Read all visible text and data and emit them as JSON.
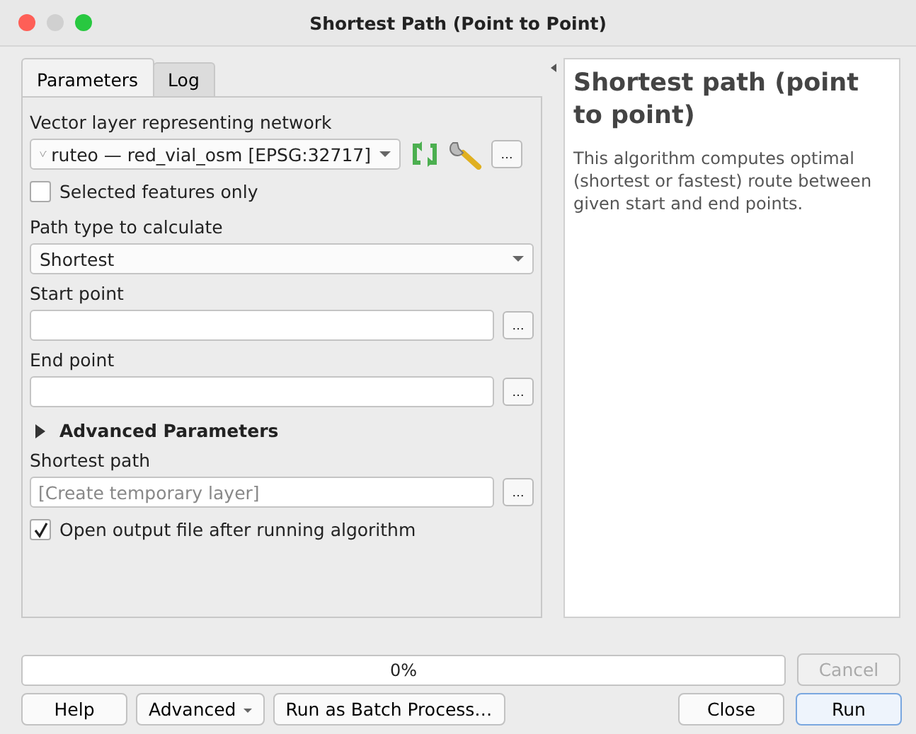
{
  "window": {
    "title": "Shortest Path (Point to Point)"
  },
  "tabs": [
    {
      "label": "Parameters",
      "selected": true
    },
    {
      "label": "Log",
      "selected": false
    }
  ],
  "parameters": [
    {
      "kind": "layer",
      "label": "Vector layer representing network",
      "value": "ruteo — red_vial_osm [EPSG:32717]",
      "button": "…"
    },
    {
      "kind": "checkbox",
      "label": "Selected features only",
      "checked": false
    },
    {
      "kind": "select",
      "label": "Path type to calculate",
      "value": "Shortest"
    },
    {
      "kind": "point",
      "label": "Start point",
      "button": "…"
    },
    {
      "kind": "point",
      "label": "End point",
      "button": "…"
    },
    {
      "kind": "group",
      "label": "Advanced Parameters",
      "expanded": false
    },
    {
      "kind": "output",
      "label": "Shortest path",
      "placeholder": "[Create temporary layer]",
      "button": "…"
    },
    {
      "kind": "checkbox",
      "label": "Open output file after running algorithm",
      "checked": true
    }
  ],
  "help": {
    "title": "Shortest path (point to point)",
    "text": "This algorithm computes optimal (shortest or fastest) route between given start and end points."
  },
  "progress": {
    "level": 0,
    "reading": "0%"
  },
  "cancel_button": {
    "label": "Cancel",
    "disabled": true
  },
  "left_buttons": [
    {
      "label": "Help",
      "menu": false
    },
    {
      "label": "Advanced",
      "menu": true
    },
    {
      "label": "Run as Batch Process…",
      "menu": false
    }
  ],
  "right_buttons": [
    {
      "label": "Close",
      "default": false
    },
    {
      "label": "Run",
      "default": true
    }
  ]
}
